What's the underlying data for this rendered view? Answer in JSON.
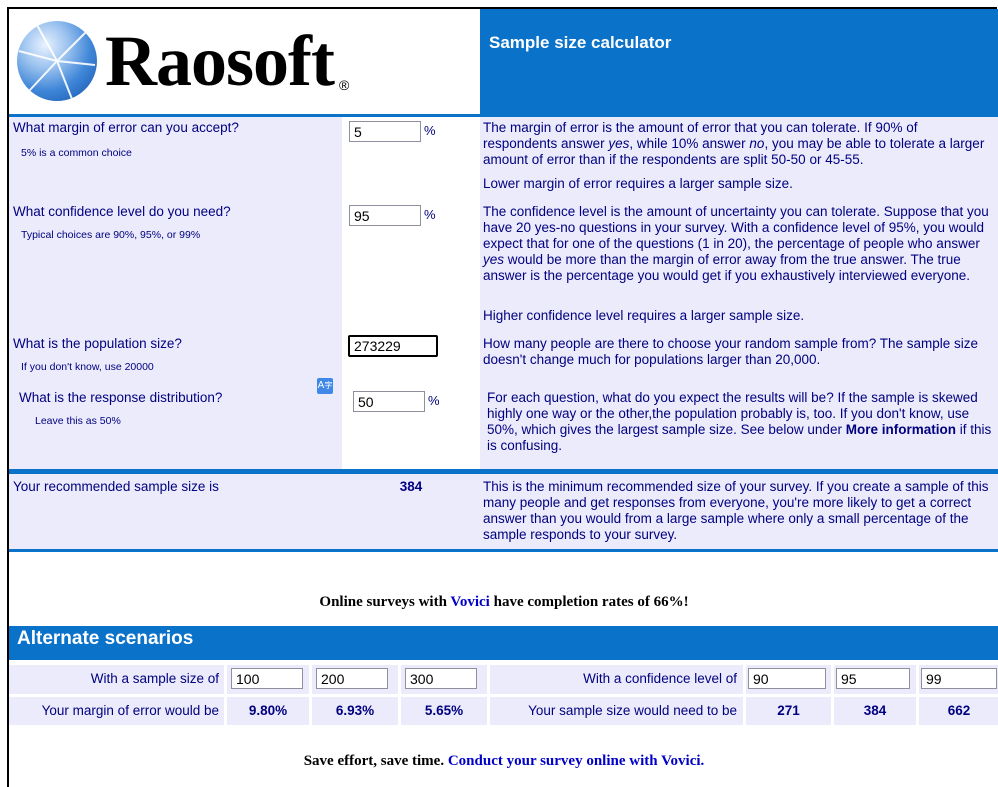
{
  "header": {
    "logo_text": "Raosoft",
    "logo_reg": "®",
    "title": "Sample size calculator"
  },
  "rows": {
    "margin": {
      "question": "What margin of error can you accept?",
      "hint": "5% is a common choice",
      "value": "5",
      "unit": "%",
      "desc1_a": "The margin of error is the amount of error that you can tolerate. If 90% of respondents answer ",
      "desc1_b": "yes",
      "desc1_c": ", while 10% answer ",
      "desc1_d": "no",
      "desc1_e": ", you may be able to tolerate a larger amount of error than if the respondents are split 50-50 or 45-55.",
      "desc2": "Lower margin of error requires a larger sample size."
    },
    "confidence": {
      "question": "What confidence level do you need?",
      "hint": "Typical choices are 90%, 95%, or 99%",
      "value": "95",
      "unit": "%",
      "desc1_a": "The confidence level is the amount of uncertainty you can tolerate. Suppose that you have 20 yes-no questions in your survey. With a confidence level of 95%, you would expect that for one of the questions (1 in 20), the percentage of people who answer ",
      "desc1_b": "yes",
      "desc1_c": " would be more than the margin of error away from the true answer. The true answer is the percentage you would get if you exhaustively interviewed everyone.",
      "desc2": "Higher confidence level requires a larger sample size."
    },
    "population": {
      "question": "What is the population size?",
      "hint": "If you don't know, use 20000",
      "value": "273229",
      "desc": "How many people are there to choose your random sample from? The sample size doesn't change much for populations larger than 20,000."
    },
    "distribution": {
      "question": "What is the response distribution?",
      "hint": "Leave this as 50%",
      "value": "50",
      "unit": "%",
      "desc_a": "For each question, what do you expect the results will be? If the sample is skewed highly one way or the other,the population probably is, too. If you don't know, use 50%, which gives the largest sample size. See below under ",
      "desc_b": "More information",
      "desc_c": " if this is confusing."
    }
  },
  "result": {
    "label": "Your recommended sample size is",
    "value": "384",
    "desc": "This is the minimum recommended size of your survey. If you create a sample of this many people and get responses from everyone, you're more likely to get a correct answer than you would from a large sample where only a small percentage of the sample responds to your survey."
  },
  "promo1": {
    "before": "Online surveys with ",
    "link": "Vovici",
    "after": " have completion rates of 66%!"
  },
  "alternate": {
    "title": "Alternate scenarios",
    "sample_label": "With a sample size of",
    "sample_values": [
      "100",
      "200",
      "300"
    ],
    "margin_label": "Your margin of error would be",
    "margin_values": [
      "9.80%",
      "6.93%",
      "5.65%"
    ],
    "conf_label": "With a confidence level of",
    "conf_values": [
      "90",
      "95",
      "99"
    ],
    "need_label": "Your sample size would need to be",
    "need_values": [
      "271",
      "384",
      "662"
    ]
  },
  "promo2": {
    "before": "Save effort, save time. ",
    "link": "Conduct your survey online with Vovici."
  },
  "icons": {
    "translate": "translate-icon"
  }
}
